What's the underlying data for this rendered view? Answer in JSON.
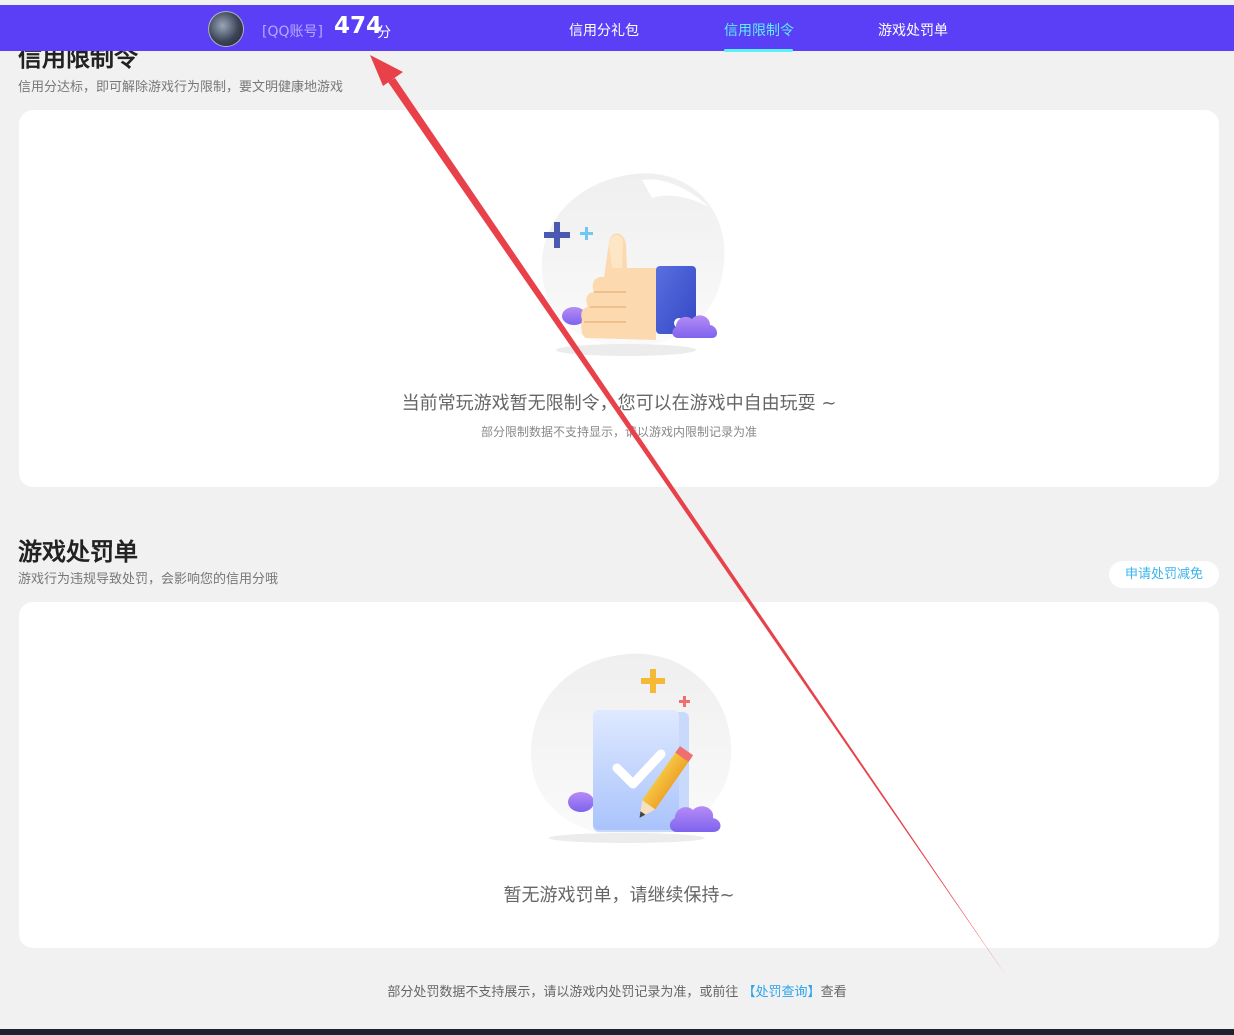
{
  "header": {
    "account_label": "[QQ账号]",
    "score": "474",
    "score_unit": "分",
    "tabs": [
      {
        "label": "信用分礼包"
      },
      {
        "label": "信用限制令"
      },
      {
        "label": "游戏处罚单"
      }
    ],
    "active_tab": "信用限制令"
  },
  "restriction": {
    "title": "信用限制令",
    "subtitle": "信用分达标，即可解除游戏行为限制，要文明健康地游戏",
    "empty_message": "当前常玩游戏暂无限制令，您可以在游戏中自由玩耍 ~",
    "empty_note": "部分限制数据不支持显示，请以游戏内限制记录为准"
  },
  "penalty": {
    "title": "游戏处罚单",
    "subtitle": "游戏行为违规导致处罚，会影响您的信用分哦",
    "appeal_button": "申请处罚减免",
    "empty_message": "暂无游戏罚单，请继续保持~"
  },
  "footer": {
    "text_before": "部分处罚数据不支持展示，请以游戏内处罚记录为准，或前往 ",
    "link": "【处罚查询】",
    "text_after": "查看"
  },
  "colors": {
    "navbar": "#5a3ff6",
    "active_tab": "#5cf0f7",
    "link": "#2aa4ea",
    "annotation_arrow": "#e8414a"
  },
  "icons": {
    "restriction_empty": "thumbs-up-illustration",
    "penalty_empty": "clipboard-check-illustration"
  }
}
